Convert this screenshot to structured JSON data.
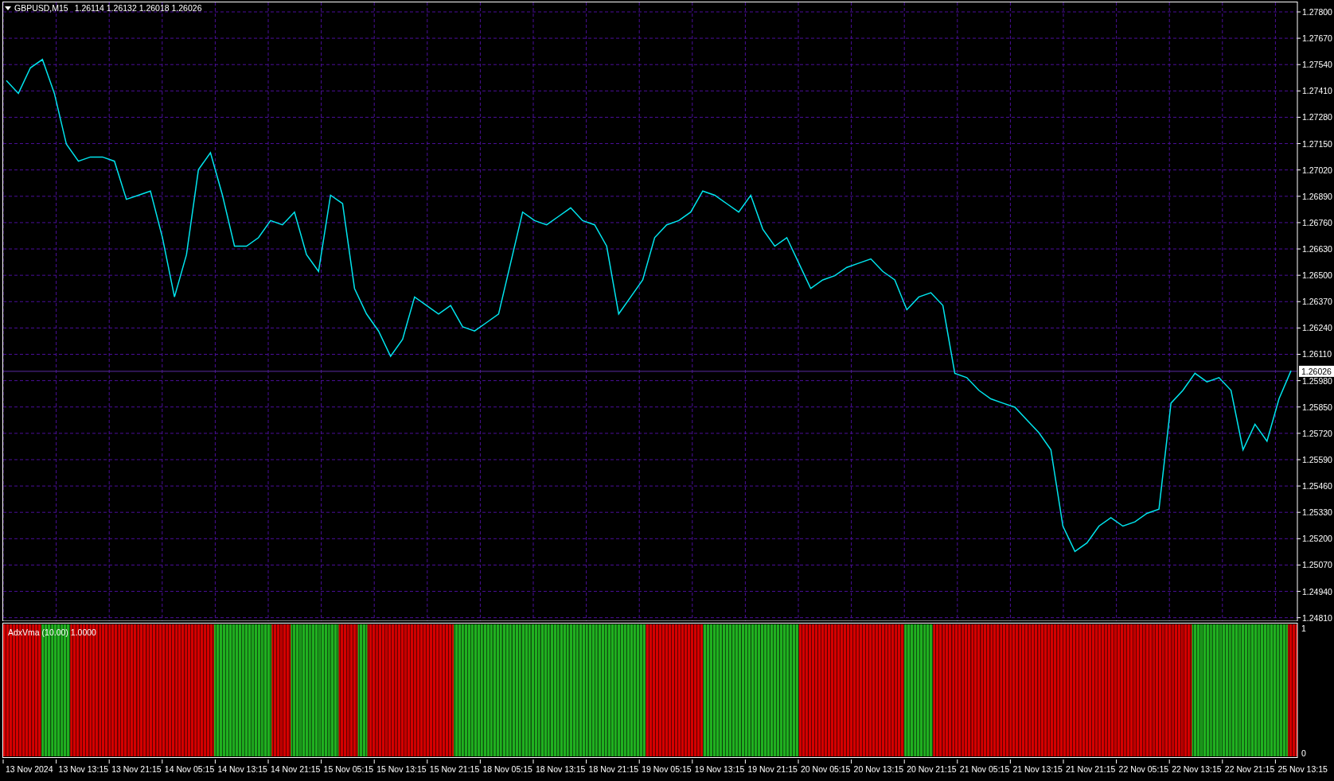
{
  "header": {
    "symbol": "GBPUSD,M15",
    "ohlc": [
      "1.26114",
      "1.26132",
      "1.26018",
      "1.26026"
    ]
  },
  "price_chart": {
    "chart_data": {
      "type": "line",
      "grid": true,
      "ylim": [
        1.24793,
        1.27847
      ],
      "ref_lines": [
        {
          "axis": "y",
          "value": 1.26026,
          "label": "1.26026"
        }
      ],
      "yticks": [
        {
          "value": 1.278,
          "label": "1.27800"
        },
        {
          "value": 1.2767,
          "label": "1.27670"
        },
        {
          "value": 1.2754,
          "label": "1.27540"
        },
        {
          "value": 1.2741,
          "label": "1.27410"
        },
        {
          "value": 1.2728,
          "label": "1.27280"
        },
        {
          "value": 1.2715,
          "label": "1.27150"
        },
        {
          "value": 1.2702,
          "label": "1.27020"
        },
        {
          "value": 1.2689,
          "label": "1.26890"
        },
        {
          "value": 1.2676,
          "label": "1.26760"
        },
        {
          "value": 1.2663,
          "label": "1.26630"
        },
        {
          "value": 1.265,
          "label": "1.26500"
        },
        {
          "value": 1.2637,
          "label": "1.26370"
        },
        {
          "value": 1.2624,
          "label": "1.26240"
        },
        {
          "value": 1.2611,
          "label": "1.26110"
        },
        {
          "value": 1.2598,
          "label": "1.25980"
        },
        {
          "value": 1.2585,
          "label": "1.25850"
        },
        {
          "value": 1.2572,
          "label": "1.25720"
        },
        {
          "value": 1.2559,
          "label": "1.25590"
        },
        {
          "value": 1.2546,
          "label": "1.25460"
        },
        {
          "value": 1.2533,
          "label": "1.25330"
        },
        {
          "value": 1.252,
          "label": "1.25200"
        },
        {
          "value": 1.2507,
          "label": "1.25070"
        },
        {
          "value": 1.2494,
          "label": "1.24940"
        },
        {
          "value": 1.2481,
          "label": "1.24810"
        }
      ],
      "series": [
        {
          "color": "#00e5ee",
          "values": [
            1.27461,
            1.27398,
            1.27524,
            1.27565,
            1.27398,
            1.27147,
            1.27063,
            1.27084,
            1.27084,
            1.27063,
            1.26875,
            1.26895,
            1.26916,
            1.26686,
            1.26393,
            1.26602,
            1.27021,
            1.27105,
            1.26895,
            1.26644,
            1.26644,
            1.26686,
            1.2677,
            1.26749,
            1.26812,
            1.26602,
            1.26519,
            1.26895,
            1.26854,
            1.26435,
            1.26309,
            1.26225,
            1.261,
            1.26184,
            1.26393,
            1.26351,
            1.26309,
            1.26351,
            1.26246,
            1.26225,
            1.26267,
            1.26309,
            1.2656,
            1.26812,
            1.2677,
            1.26749,
            1.26791,
            1.26833,
            1.2677,
            1.26749,
            1.26644,
            1.26309,
            1.26393,
            1.26477,
            1.26686,
            1.26749,
            1.2677,
            1.26812,
            1.26916,
            1.26895,
            1.26854,
            1.26812,
            1.26895,
            1.26728,
            1.26644,
            1.26686,
            1.2656,
            1.26435,
            1.26477,
            1.26498,
            1.26539,
            1.2656,
            1.26581,
            1.26519,
            1.26477,
            1.2633,
            1.26393,
            1.26414,
            1.26351,
            1.26016,
            1.25995,
            1.25932,
            1.2589,
            1.25869,
            1.25849,
            1.25786,
            1.25723,
            1.25639,
            1.25262,
            1.25137,
            1.25179,
            1.25262,
            1.25304,
            1.25262,
            1.25283,
            1.25325,
            1.25346,
            1.25869,
            1.25932,
            1.26016,
            1.25974,
            1.25995,
            1.25932,
            1.25639,
            1.25765,
            1.25681,
            1.2589,
            1.26029
          ]
        }
      ]
    }
  },
  "indicator": {
    "label": "AdxVma (10.00) 1.0000",
    "scale": [
      "1",
      "0"
    ],
    "bars": [
      {
        "color": "#d40000"
      },
      {
        "color": "#d40000"
      },
      {
        "color": "#d40000"
      },
      {
        "color": "#d40000"
      },
      {
        "color": "#20b020"
      },
      {
        "color": "#20b020"
      },
      {
        "color": "#20b020"
      },
      {
        "color": "#d40000"
      },
      {
        "color": "#d40000"
      },
      {
        "color": "#d40000"
      },
      {
        "color": "#d40000"
      },
      {
        "color": "#d40000"
      },
      {
        "color": "#d40000"
      },
      {
        "color": "#d40000"
      },
      {
        "color": "#d40000"
      },
      {
        "color": "#d40000"
      },
      {
        "color": "#d40000"
      },
      {
        "color": "#d40000"
      },
      {
        "color": "#d40000"
      },
      {
        "color": "#d40000"
      },
      {
        "color": "#d40000"
      },
      {
        "color": "#d40000"
      },
      {
        "color": "#20b020"
      },
      {
        "color": "#20b020"
      },
      {
        "color": "#20b020"
      },
      {
        "color": "#20b020"
      },
      {
        "color": "#20b020"
      },
      {
        "color": "#20b020"
      },
      {
        "color": "#d40000"
      },
      {
        "color": "#d40000"
      },
      {
        "color": "#20b020"
      },
      {
        "color": "#20b020"
      },
      {
        "color": "#20b020"
      },
      {
        "color": "#20b020"
      },
      {
        "color": "#20b020"
      },
      {
        "color": "#d40000"
      },
      {
        "color": "#d40000"
      },
      {
        "color": "#20b020"
      },
      {
        "color": "#d40000"
      },
      {
        "color": "#d40000"
      },
      {
        "color": "#d40000"
      },
      {
        "color": "#d40000"
      },
      {
        "color": "#d40000"
      },
      {
        "color": "#d40000"
      },
      {
        "color": "#d40000"
      },
      {
        "color": "#d40000"
      },
      {
        "color": "#d40000"
      },
      {
        "color": "#20b020"
      },
      {
        "color": "#20b020"
      },
      {
        "color": "#20b020"
      },
      {
        "color": "#20b020"
      },
      {
        "color": "#20b020"
      },
      {
        "color": "#20b020"
      },
      {
        "color": "#20b020"
      },
      {
        "color": "#20b020"
      },
      {
        "color": "#20b020"
      },
      {
        "color": "#20b020"
      },
      {
        "color": "#20b020"
      },
      {
        "color": "#20b020"
      },
      {
        "color": "#20b020"
      },
      {
        "color": "#20b020"
      },
      {
        "color": "#20b020"
      },
      {
        "color": "#20b020"
      },
      {
        "color": "#20b020"
      },
      {
        "color": "#20b020"
      },
      {
        "color": "#20b020"
      },
      {
        "color": "#20b020"
      },
      {
        "color": "#d40000"
      },
      {
        "color": "#d40000"
      },
      {
        "color": "#d40000"
      },
      {
        "color": "#d40000"
      },
      {
        "color": "#d40000"
      },
      {
        "color": "#d40000"
      },
      {
        "color": "#20b020"
      },
      {
        "color": "#20b020"
      },
      {
        "color": "#20b020"
      },
      {
        "color": "#20b020"
      },
      {
        "color": "#20b020"
      },
      {
        "color": "#20b020"
      },
      {
        "color": "#20b020"
      },
      {
        "color": "#20b020"
      },
      {
        "color": "#20b020"
      },
      {
        "color": "#20b020"
      },
      {
        "color": "#d40000"
      },
      {
        "color": "#d40000"
      },
      {
        "color": "#d40000"
      },
      {
        "color": "#d40000"
      },
      {
        "color": "#d40000"
      },
      {
        "color": "#d40000"
      },
      {
        "color": "#d40000"
      },
      {
        "color": "#d40000"
      },
      {
        "color": "#d40000"
      },
      {
        "color": "#d40000"
      },
      {
        "color": "#d40000"
      },
      {
        "color": "#20b020"
      },
      {
        "color": "#20b020"
      },
      {
        "color": "#20b020"
      },
      {
        "color": "#d40000"
      },
      {
        "color": "#d40000"
      },
      {
        "color": "#d40000"
      },
      {
        "color": "#d40000"
      },
      {
        "color": "#d40000"
      },
      {
        "color": "#d40000"
      },
      {
        "color": "#d40000"
      },
      {
        "color": "#d40000"
      },
      {
        "color": "#d40000"
      },
      {
        "color": "#d40000"
      },
      {
        "color": "#d40000"
      },
      {
        "color": "#d40000"
      },
      {
        "color": "#d40000"
      },
      {
        "color": "#d40000"
      },
      {
        "color": "#d40000"
      },
      {
        "color": "#d40000"
      },
      {
        "color": "#d40000"
      },
      {
        "color": "#d40000"
      },
      {
        "color": "#d40000"
      },
      {
        "color": "#d40000"
      },
      {
        "color": "#d40000"
      },
      {
        "color": "#d40000"
      },
      {
        "color": "#d40000"
      },
      {
        "color": "#d40000"
      },
      {
        "color": "#d40000"
      },
      {
        "color": "#d40000"
      },
      {
        "color": "#d40000"
      },
      {
        "color": "#20b020"
      },
      {
        "color": "#20b020"
      },
      {
        "color": "#20b020"
      },
      {
        "color": "#20b020"
      },
      {
        "color": "#20b020"
      },
      {
        "color": "#20b020"
      },
      {
        "color": "#20b020"
      },
      {
        "color": "#20b020"
      },
      {
        "color": "#20b020"
      },
      {
        "color": "#20b020"
      },
      {
        "color": "#d40000"
      }
    ]
  },
  "time_axis": {
    "labels": [
      "13 Nov 2024",
      "13 Nov 13:15",
      "13 Nov 21:15",
      "14 Nov 05:15",
      "14 Nov 13:15",
      "14 Nov 21:15",
      "15 Nov 05:15",
      "15 Nov 13:15",
      "15 Nov 21:15",
      "18 Nov 05:15",
      "18 Nov 13:15",
      "18 Nov 21:15",
      "19 Nov 05:15",
      "19 Nov 13:15",
      "19 Nov 21:15",
      "20 Nov 05:15",
      "20 Nov 13:15",
      "20 Nov 21:15",
      "21 Nov 05:15",
      "21 Nov 13:15",
      "21 Nov 21:15",
      "22 Nov 05:15",
      "22 Nov 13:15",
      "22 Nov 21:15",
      "25 Nov 13:15"
    ]
  }
}
